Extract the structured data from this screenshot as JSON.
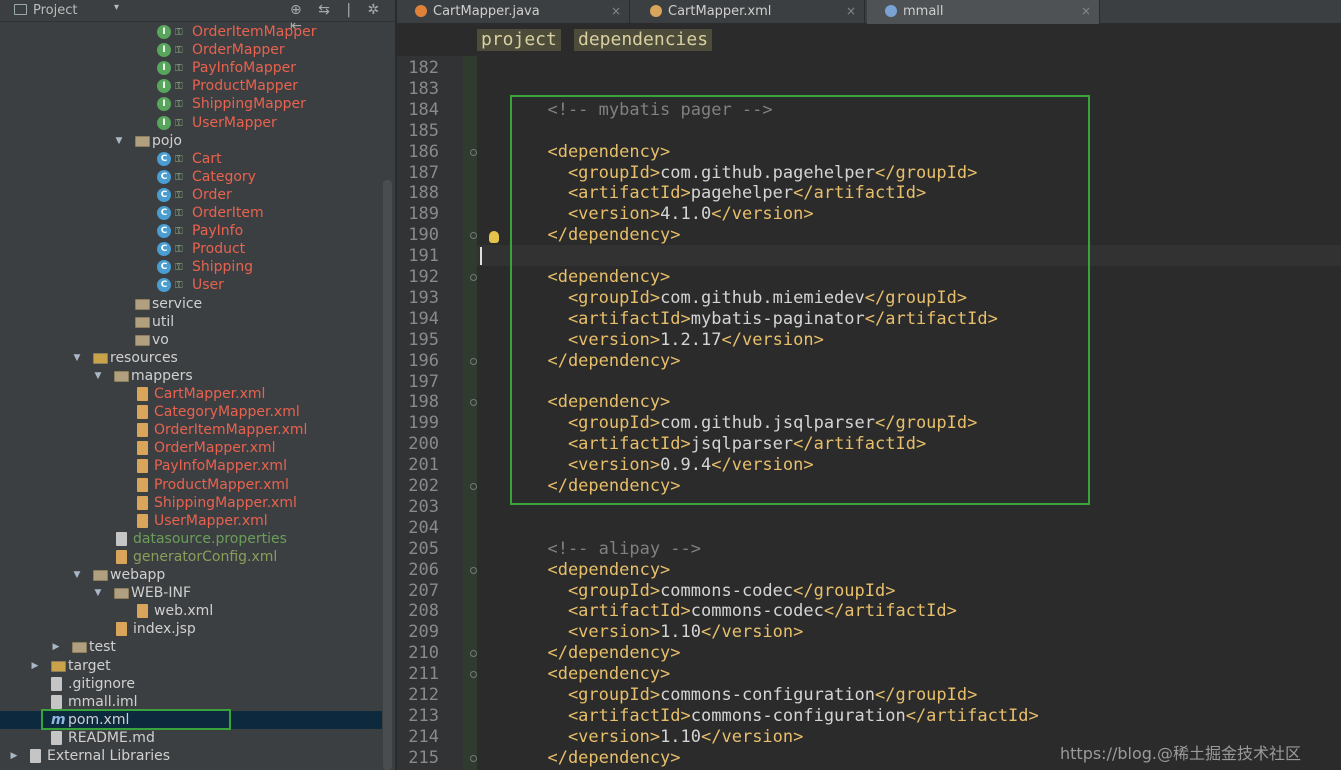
{
  "project_panel": {
    "title": "Project",
    "dropdown": "▾",
    "tools": "⊕ ⇆ | ✲ ⇤"
  },
  "tree": [
    {
      "label": "OrderItemMapper",
      "icon": "I",
      "kind": "interface",
      "color": "red",
      "indent": 157
    },
    {
      "label": "OrderMapper",
      "icon": "I",
      "kind": "interface",
      "color": "red",
      "indent": 157
    },
    {
      "label": "PayInfoMapper",
      "icon": "I",
      "kind": "interface",
      "color": "red",
      "indent": 157
    },
    {
      "label": "ProductMapper",
      "icon": "I",
      "kind": "interface",
      "color": "red",
      "indent": 157
    },
    {
      "label": "ShippingMapper",
      "icon": "I",
      "kind": "interface",
      "color": "red",
      "indent": 157
    },
    {
      "label": "UserMapper",
      "icon": "I",
      "kind": "interface",
      "color": "red",
      "indent": 157
    },
    {
      "label": "pojo",
      "kind": "folder",
      "color": "white",
      "indent": 135,
      "arrow": "▼"
    },
    {
      "label": "Cart",
      "icon": "C",
      "kind": "class",
      "color": "red",
      "indent": 157
    },
    {
      "label": "Category",
      "icon": "C",
      "kind": "class",
      "color": "red",
      "indent": 157
    },
    {
      "label": "Order",
      "icon": "C",
      "kind": "class",
      "color": "red",
      "indent": 157
    },
    {
      "label": "OrderItem",
      "icon": "C",
      "kind": "class",
      "color": "red",
      "indent": 157
    },
    {
      "label": "PayInfo",
      "icon": "C",
      "kind": "class",
      "color": "red",
      "indent": 157
    },
    {
      "label": "Product",
      "icon": "C",
      "kind": "class",
      "color": "red",
      "indent": 157
    },
    {
      "label": "Shipping",
      "icon": "C",
      "kind": "class",
      "color": "red",
      "indent": 157
    },
    {
      "label": "User",
      "icon": "C",
      "kind": "class",
      "color": "red",
      "indent": 157
    },
    {
      "label": "service",
      "kind": "folder",
      "color": "white",
      "indent": 135
    },
    {
      "label": "util",
      "kind": "folder",
      "color": "white",
      "indent": 135
    },
    {
      "label": "vo",
      "kind": "folder",
      "color": "white",
      "indent": 135
    },
    {
      "label": "resources",
      "kind": "folder-res",
      "color": "white",
      "indent": 93,
      "arrow": "▼"
    },
    {
      "label": "mappers",
      "kind": "folder",
      "color": "white",
      "indent": 114,
      "arrow": "▼"
    },
    {
      "label": "CartMapper.xml",
      "kind": "xml",
      "color": "red",
      "indent": 137
    },
    {
      "label": "CategoryMapper.xml",
      "kind": "xml",
      "color": "red",
      "indent": 137
    },
    {
      "label": "OrderItemMapper.xml",
      "kind": "xml",
      "color": "red",
      "indent": 137
    },
    {
      "label": "OrderMapper.xml",
      "kind": "xml",
      "color": "red",
      "indent": 137
    },
    {
      "label": "PayInfoMapper.xml",
      "kind": "xml",
      "color": "red",
      "indent": 137
    },
    {
      "label": "ProductMapper.xml",
      "kind": "xml",
      "color": "red",
      "indent": 137
    },
    {
      "label": "ShippingMapper.xml",
      "kind": "xml",
      "color": "red",
      "indent": 137
    },
    {
      "label": "UserMapper.xml",
      "kind": "xml",
      "color": "red",
      "indent": 137
    },
    {
      "label": "datasource.properties",
      "kind": "props",
      "color": "green",
      "indent": 116
    },
    {
      "label": "generatorConfig.xml",
      "kind": "xml",
      "color": "olive",
      "indent": 116
    },
    {
      "label": "webapp",
      "kind": "folder",
      "color": "white",
      "indent": 93,
      "arrow": "▼"
    },
    {
      "label": "WEB-INF",
      "kind": "folder",
      "color": "white",
      "indent": 114,
      "arrow": "▼"
    },
    {
      "label": "web.xml",
      "kind": "xml",
      "color": "white",
      "indent": 137
    },
    {
      "label": "index.jsp",
      "kind": "xml",
      "color": "white",
      "indent": 116
    },
    {
      "label": "test",
      "kind": "folder",
      "color": "white",
      "indent": 72,
      "arrow": "▶"
    },
    {
      "label": "target",
      "kind": "folder-res",
      "color": "white",
      "indent": 51,
      "arrow": "▶"
    },
    {
      "label": ".gitignore",
      "kind": "text",
      "color": "white",
      "indent": 51
    },
    {
      "label": "mmall.iml",
      "kind": "iml",
      "color": "white",
      "indent": 51
    },
    {
      "label": "pom.xml",
      "kind": "maven",
      "color": "white",
      "indent": 51,
      "selected": true
    },
    {
      "label": "README.md",
      "kind": "text",
      "color": "white",
      "indent": 51
    },
    {
      "label": "External Libraries",
      "kind": "lib",
      "color": "white",
      "indent": 30,
      "arrow": "▶"
    }
  ],
  "tabs": [
    {
      "label": "CartMapper.java",
      "icon": "java",
      "close": "×"
    },
    {
      "label": "CartMapper.xml",
      "icon": "xml",
      "close": "×"
    },
    {
      "label": "mmall",
      "icon": "m",
      "close": "×",
      "active": true
    }
  ],
  "breadcrumbs": [
    "project",
    "dependencies"
  ],
  "code_lines": [
    {
      "n": "182",
      "parts": []
    },
    {
      "n": "183",
      "parts": []
    },
    {
      "n": "184",
      "parts": [
        [
          "cm",
          "  <!-- mybatis pager -->"
        ]
      ]
    },
    {
      "n": "185",
      "parts": []
    },
    {
      "n": "186",
      "parts": [
        [
          "t",
          "  <dependency>"
        ]
      ],
      "fold": true
    },
    {
      "n": "187",
      "parts": [
        [
          "t",
          "    <groupId>"
        ],
        [
          "x",
          "com.github.pagehelper"
        ],
        [
          "t",
          "</groupId>"
        ]
      ]
    },
    {
      "n": "188",
      "parts": [
        [
          "t",
          "    <artifactId>"
        ],
        [
          "x",
          "pagehelper"
        ],
        [
          "t",
          "</artifactId>"
        ]
      ]
    },
    {
      "n": "189",
      "parts": [
        [
          "t",
          "    <version>"
        ],
        [
          "x",
          "4.1.0"
        ],
        [
          "t",
          "</version>"
        ]
      ]
    },
    {
      "n": "190",
      "parts": [
        [
          "t",
          "  </dependency>"
        ]
      ],
      "fold": true
    },
    {
      "n": "191",
      "parts": []
    },
    {
      "n": "192",
      "parts": [
        [
          "t",
          "  <dependency>"
        ]
      ],
      "fold": true
    },
    {
      "n": "193",
      "parts": [
        [
          "t",
          "    <groupId>"
        ],
        [
          "x",
          "com.github.miemiedev"
        ],
        [
          "t",
          "</groupId>"
        ]
      ]
    },
    {
      "n": "194",
      "parts": [
        [
          "t",
          "    <artifactId>"
        ],
        [
          "x",
          "mybatis-paginator"
        ],
        [
          "t",
          "</artifactId>"
        ]
      ]
    },
    {
      "n": "195",
      "parts": [
        [
          "t",
          "    <version>"
        ],
        [
          "x",
          "1.2.17"
        ],
        [
          "t",
          "</version>"
        ]
      ]
    },
    {
      "n": "196",
      "parts": [
        [
          "t",
          "  </dependency>"
        ]
      ],
      "fold": true
    },
    {
      "n": "197",
      "parts": []
    },
    {
      "n": "198",
      "parts": [
        [
          "t",
          "  <dependency>"
        ]
      ],
      "fold": true
    },
    {
      "n": "199",
      "parts": [
        [
          "t",
          "    <groupId>"
        ],
        [
          "x",
          "com.github.jsqlparser"
        ],
        [
          "t",
          "</groupId>"
        ]
      ]
    },
    {
      "n": "200",
      "parts": [
        [
          "t",
          "    <artifactId>"
        ],
        [
          "x",
          "jsqlparser"
        ],
        [
          "t",
          "</artifactId>"
        ]
      ]
    },
    {
      "n": "201",
      "parts": [
        [
          "t",
          "    <version>"
        ],
        [
          "x",
          "0.9.4"
        ],
        [
          "t",
          "</version>"
        ]
      ]
    },
    {
      "n": "202",
      "parts": [
        [
          "t",
          "  </dependency>"
        ]
      ],
      "fold": true
    },
    {
      "n": "203",
      "parts": []
    },
    {
      "n": "204",
      "parts": []
    },
    {
      "n": "205",
      "parts": [
        [
          "cm",
          "  <!-- alipay -->"
        ]
      ]
    },
    {
      "n": "206",
      "parts": [
        [
          "t",
          "  <dependency>"
        ]
      ],
      "fold": true
    },
    {
      "n": "207",
      "parts": [
        [
          "t",
          "    <groupId>"
        ],
        [
          "x",
          "commons-codec"
        ],
        [
          "t",
          "</groupId>"
        ]
      ]
    },
    {
      "n": "208",
      "parts": [
        [
          "t",
          "    <artifactId>"
        ],
        [
          "x",
          "commons-codec"
        ],
        [
          "t",
          "</artifactId>"
        ]
      ]
    },
    {
      "n": "209",
      "parts": [
        [
          "t",
          "    <version>"
        ],
        [
          "x",
          "1.10"
        ],
        [
          "t",
          "</version>"
        ]
      ]
    },
    {
      "n": "210",
      "parts": [
        [
          "t",
          "  </dependency>"
        ]
      ],
      "fold": true
    },
    {
      "n": "211",
      "parts": [
        [
          "t",
          "  <dependency>"
        ]
      ],
      "fold": true
    },
    {
      "n": "212",
      "parts": [
        [
          "t",
          "    <groupId>"
        ],
        [
          "x",
          "commons-configuration"
        ],
        [
          "t",
          "</groupId>"
        ]
      ]
    },
    {
      "n": "213",
      "parts": [
        [
          "t",
          "    <artifactId>"
        ],
        [
          "x",
          "commons-configuration"
        ],
        [
          "t",
          "</artifactId>"
        ]
      ]
    },
    {
      "n": "214",
      "parts": [
        [
          "t",
          "    <version>"
        ],
        [
          "x",
          "1.10"
        ],
        [
          "t",
          "</version>"
        ]
      ]
    },
    {
      "n": "215",
      "parts": [
        [
          "t",
          "  </dependency>"
        ]
      ],
      "fold": true
    }
  ],
  "watermark": "https://blog.@稀土掘金技术社区",
  "colors": {
    "accent_box": "#3aa23a",
    "tag": "#e8bf6a",
    "red_file": "#e8624f"
  }
}
